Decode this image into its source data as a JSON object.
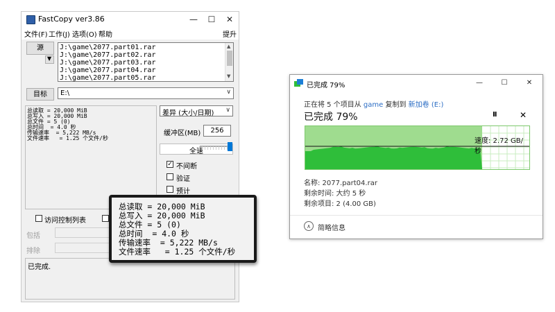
{
  "fastcopy": {
    "title": "FastCopy ver3.86",
    "window_controls": {
      "minimize": "—",
      "maximize": "☐",
      "close": "✕"
    },
    "menu": [
      "文件(F)",
      "工作(J)",
      "选项(O)",
      "帮助"
    ],
    "menu_right": "提升",
    "source_button": "源",
    "source_files": [
      "J:\\game\\2077.part01.rar",
      "J:\\game\\2077.part02.rar",
      "J:\\game\\2077.part03.rar",
      "J:\\game\\2077.part04.rar",
      "J:\\game\\2077.part05.rar"
    ],
    "dest_button": "目标",
    "dest_path": "E:\\",
    "stats": [
      "总读取 = 20,000 MiB",
      "总写入 = 20,000 MiB",
      "总文件 = 5 (0)",
      "总时间  = 4.0 秒",
      "传输速率  = 5,222 MB/s",
      "文件速率   = 1.25 个文件/秒"
    ],
    "mode": "差异 (大小/日期)",
    "buffer_label": "缓冲区(MB)",
    "buffer_value": "256",
    "speed_button": "全速",
    "speed_level": 1.0,
    "options": [
      {
        "label": "不间断",
        "checked": true
      },
      {
        "label": "验证",
        "checked": false
      },
      {
        "label": "预计",
        "checked": false
      }
    ],
    "acl_label": "访问控制列表",
    "include_label": "包括",
    "exclude_label": "排除",
    "log_text": "已完成."
  },
  "zoom_overlay": {
    "lines": [
      "总读取 = 20,000 MiB",
      "总写入 = 20,000 MiB",
      "总文件 = 5 (0)",
      "总时间  = 4.0 秒",
      "传输速率  = 5,222 MB/s",
      "文件速率   = 1.25 个文件/秒"
    ]
  },
  "copy_dialog": {
    "title": "已完成 79%",
    "window_controls": {
      "minimize": "—",
      "maximize": "☐",
      "close": "✕"
    },
    "desc_prefix": "正在将 5 个项目从",
    "desc_source": "game",
    "desc_middle": "复制到",
    "desc_dest": "新加卷 (E:)",
    "big_status": "已完成 79%",
    "pause_icon": "II",
    "cancel_icon": "✕",
    "progress": 0.79,
    "speed_text": "速度: 2.72 GB/秒",
    "name_line": "名称: 2077.part04.rar",
    "remaining_time": "剩余时间: 大约 5 秒",
    "remaining_items": "剩余项目: 2 (4.00 GB)",
    "fewer_details": "简略信息",
    "colors": {
      "graph_fill": "#2fbe3a",
      "graph_bg": "#9fdc8f",
      "graph_border": "#7cc86c"
    }
  }
}
